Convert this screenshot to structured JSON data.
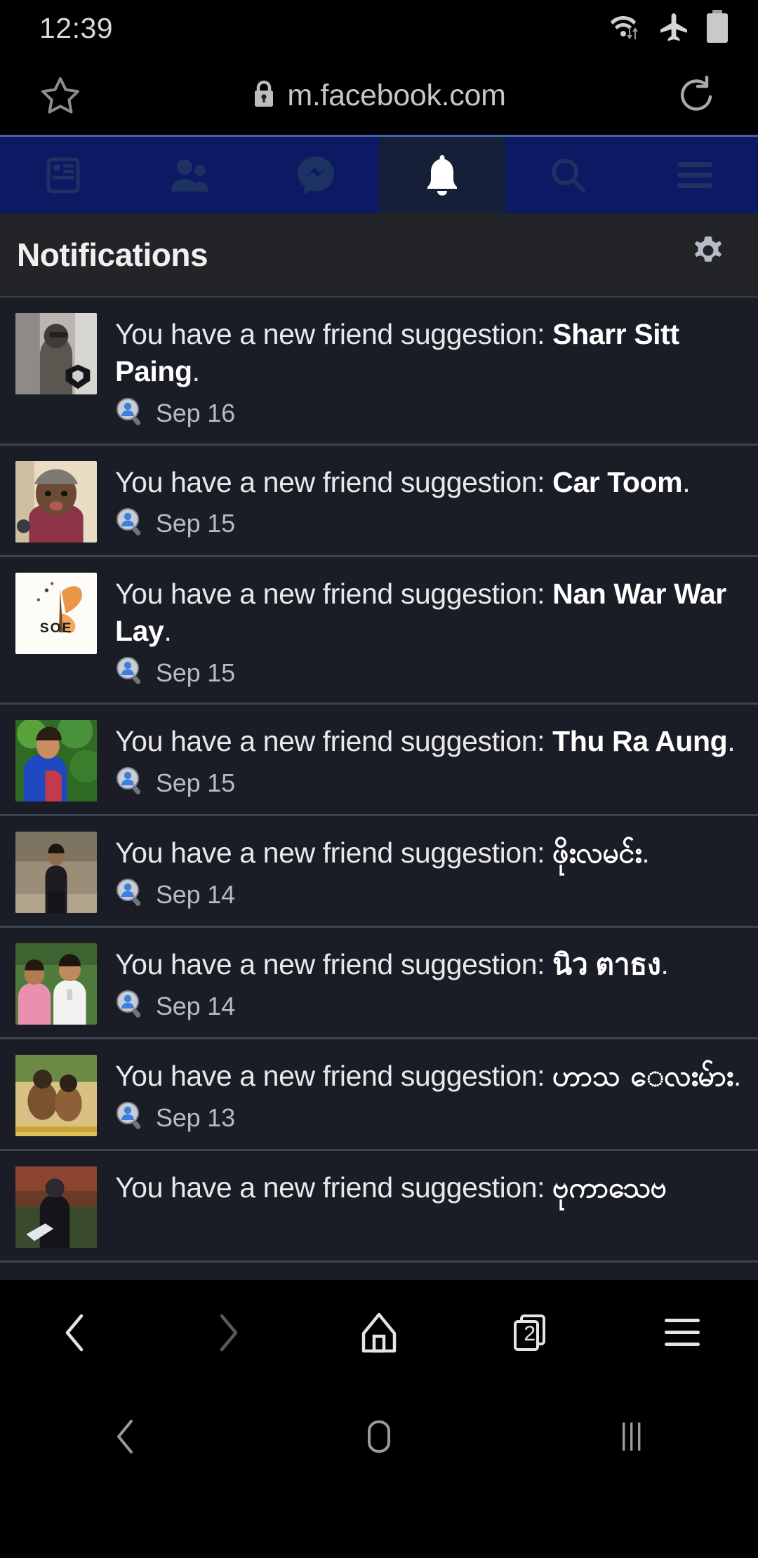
{
  "status_bar": {
    "time": "12:39",
    "icons": [
      "wifi-data-icon",
      "airplane-mode-icon",
      "battery-icon"
    ]
  },
  "browser": {
    "url": "m.facebook.com",
    "bookmark_icon": "star-icon",
    "security_icon": "lock-icon",
    "reload_icon": "reload-icon",
    "bottom_bar": {
      "back_icon": "back-chevron-icon",
      "forward_icon": "forward-chevron-icon",
      "home_icon": "home-icon",
      "tabs_icon": "tabs-icon",
      "tab_count": "2",
      "menu_icon": "hamburger-menu-icon"
    }
  },
  "facebook_nav": {
    "accent_color": "#0c1a63",
    "active_color": "#151f38",
    "items": [
      {
        "name": "news-feed",
        "icon": "newsfeed-icon",
        "active": false
      },
      {
        "name": "friends",
        "icon": "friends-icon",
        "active": false
      },
      {
        "name": "messenger",
        "icon": "messenger-icon",
        "active": false
      },
      {
        "name": "notifications",
        "icon": "bell-icon",
        "active": true
      },
      {
        "name": "search",
        "icon": "search-icon",
        "active": false
      },
      {
        "name": "menu",
        "icon": "hamburger-menu-icon",
        "active": false
      }
    ]
  },
  "page_header": {
    "title": "Notifications",
    "settings_icon": "gear-icon"
  },
  "notifications": {
    "prefix": "You have a new friend suggestion: ",
    "suffix": ".",
    "type_icon": "friend-search-icon",
    "items": [
      {
        "name": "Sharr Sitt Paing",
        "date": "Sep 16",
        "avatar": "photo-person-glasses-bw"
      },
      {
        "name": "Car Toom",
        "date": "Sep 15",
        "avatar": "photo-person-cap"
      },
      {
        "name": "Nan War War Lay",
        "date": "Sep 15",
        "avatar": "logo-butterfly-soe"
      },
      {
        "name": "Thu Ra Aung",
        "date": "Sep 15",
        "avatar": "photo-person-green"
      },
      {
        "name": "ဖိုးလမင်း",
        "date": "Sep 14",
        "avatar": "photo-person-standing"
      },
      {
        "name": "นิว ตาธง",
        "date": "Sep 14",
        "avatar": "photo-two-people"
      },
      {
        "name": "ဟာသ ေလးမ်ား",
        "date": "Sep 13",
        "avatar": "photo-children-field"
      },
      {
        "name": "ဗုကာသေဗ",
        "date": "",
        "avatar": "photo-person-outdoor"
      }
    ]
  },
  "android_nav": {
    "back_icon": "android-back-icon",
    "home_icon": "android-home-icon",
    "recents_icon": "android-recents-icon"
  }
}
